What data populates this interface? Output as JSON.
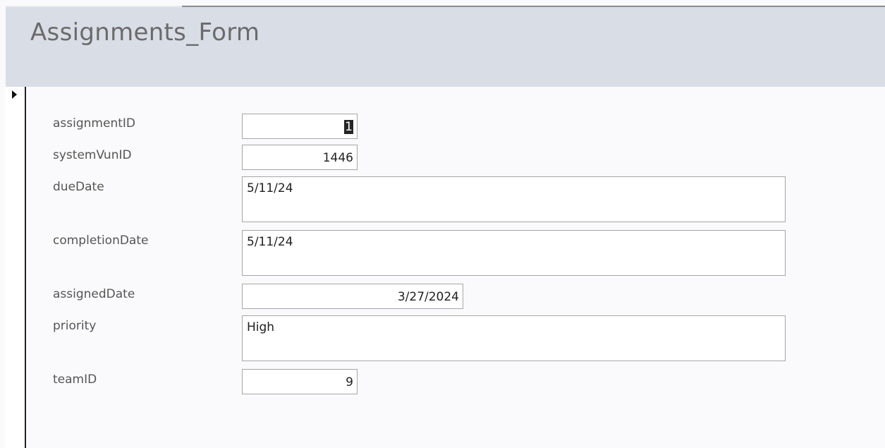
{
  "form": {
    "title": "Assignments_Form"
  },
  "fields": {
    "assignmentID": {
      "label": "assignmentID",
      "value": "1"
    },
    "systemVunID": {
      "label": "systemVunID",
      "value": "1446"
    },
    "dueDate": {
      "label": "dueDate",
      "value": "5/11/24"
    },
    "completionDate": {
      "label": "completionDate",
      "value": "5/11/24"
    },
    "assignedDate": {
      "label": "assignedDate",
      "value": "3/27/2024"
    },
    "priority": {
      "label": "priority",
      "value": "High"
    },
    "teamID": {
      "label": "teamID",
      "value": "9"
    }
  },
  "icons": {
    "record_selector": "current-record-arrow-icon"
  }
}
